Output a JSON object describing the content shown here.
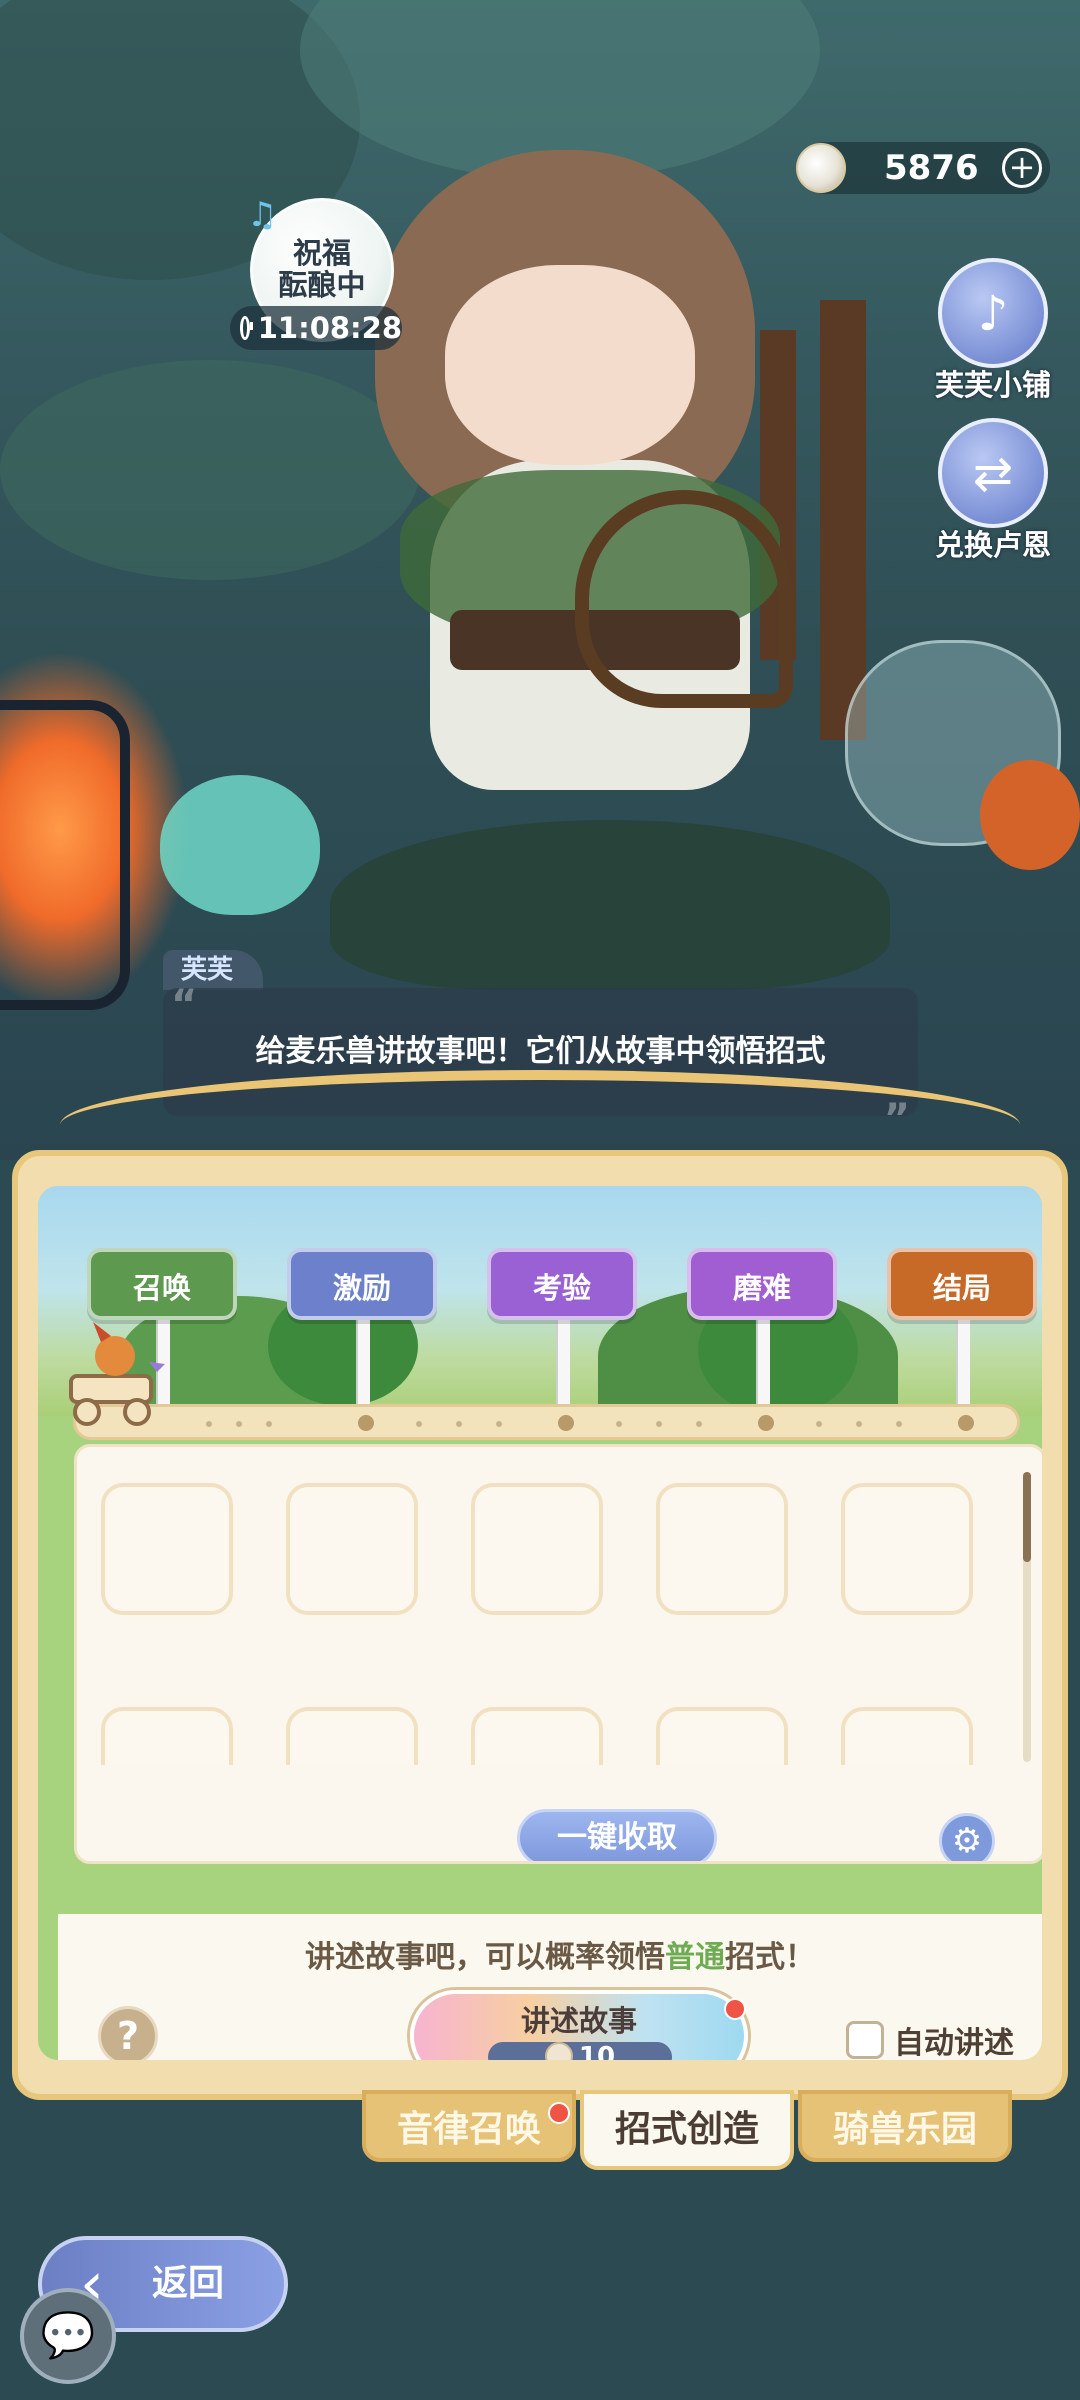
{
  "currency": {
    "value": "5876",
    "plus_symbol": "+",
    "icon": "coin-icon"
  },
  "blessing": {
    "label": "祝福\n酝酿中",
    "timer": "11:08:28",
    "icon": "music-note-icon"
  },
  "side_buttons": [
    {
      "label": "芙芙小铺",
      "icon": "lyre-shop-icon"
    },
    {
      "label": "兑换卢恩",
      "icon": "exchange-cart-icon"
    }
  ],
  "dialog": {
    "speaker": "芙芙",
    "text": "给麦乐兽讲故事吧！它们从故事中领悟招式"
  },
  "stages": [
    {
      "label": "召唤",
      "color": "#5e9950"
    },
    {
      "label": "激励",
      "color": "#6c80cc"
    },
    {
      "label": "考验",
      "color": "#9a61d4"
    },
    {
      "label": "磨难",
      "color": "#a15dd2"
    },
    {
      "label": "结局",
      "color": "#c76a28"
    }
  ],
  "grid": {
    "collect_button": "一键收取",
    "settings_icon": "gear-icon"
  },
  "action": {
    "hint_prefix": "讲述故事吧，可以概率领悟",
    "hint_highlight": "普通",
    "hint_suffix": "招式！",
    "help_symbol": "?",
    "tell_button": "讲述故事",
    "tell_cost": "10",
    "auto_label": "自动讲述",
    "auto_checked": false
  },
  "tabs": [
    {
      "label": "音律召唤",
      "active": false,
      "badge": true
    },
    {
      "label": "招式创造",
      "active": true,
      "badge": false
    },
    {
      "label": "骑兽乐园",
      "active": false,
      "badge": false
    }
  ],
  "back_button": "返回",
  "colors": {
    "panel_gold": "#e7c77b",
    "highlight_green": "#6dac53",
    "badge_red": "#f05445"
  }
}
